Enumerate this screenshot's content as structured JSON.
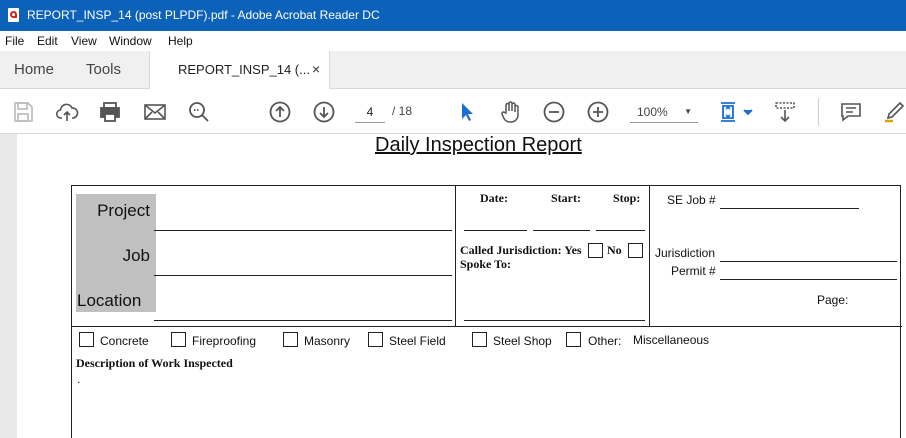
{
  "window": {
    "title": "REPORT_INSP_14 (post PLPDF).pdf - Adobe Acrobat Reader DC"
  },
  "menu": [
    "File",
    "Edit",
    "View",
    "Window",
    "Help"
  ],
  "tabs": {
    "home": "Home",
    "tools": "Tools",
    "document": "REPORT_INSP_14 (...",
    "close": "×"
  },
  "toolbar": {
    "page_current": "4",
    "page_total": "/  18",
    "zoom": "100%",
    "zoom_dropdown": "▼",
    "icons": [
      "save-icon",
      "upload-icon",
      "print-icon",
      "email-icon",
      "search-icon",
      "previous-page-icon",
      "next-page-icon",
      "select-pointer-icon",
      "hand-tool-icon",
      "zoom-out-icon",
      "zoom-in-icon",
      "fit-page-icon",
      "scroll-mode-icon",
      "comment-icon",
      "highlight-pen-icon"
    ]
  },
  "report": {
    "title": "Daily Inspection Report",
    "project_label": "Project",
    "job_label": "Job",
    "location_label": "Location",
    "date_label": "Date:",
    "start_label": "Start:",
    "stop_label": "Stop:",
    "called_jurisdiction_label": "Called Jurisdiction: Yes",
    "no_label": "No",
    "spoke_to_label": "Spoke To:",
    "se_job_label": "SE Job #",
    "jurisdiction_label": "Jurisdiction",
    "permit_label": "Permit #",
    "page_label": "Page:",
    "checkboxes": [
      "Concrete",
      "Fireproofing",
      "Masonry",
      "Steel Field",
      "Steel Shop",
      "Other:"
    ],
    "other_value": "Miscellaneous",
    "description_label": "Description of Work  Inspected",
    "description_value": "."
  }
}
